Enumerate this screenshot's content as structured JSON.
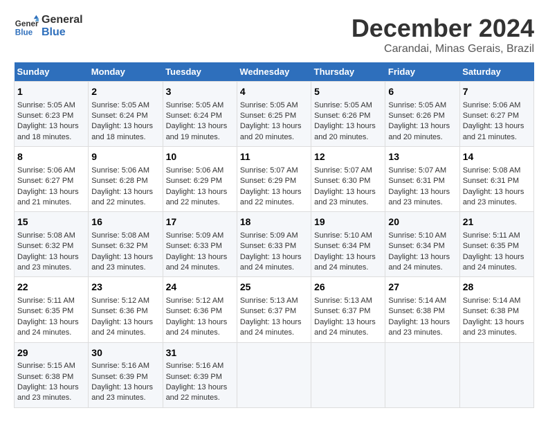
{
  "header": {
    "logo_line1": "General",
    "logo_line2": "Blue",
    "title": "December 2024",
    "subtitle": "Carandai, Minas Gerais, Brazil"
  },
  "days_of_week": [
    "Sunday",
    "Monday",
    "Tuesday",
    "Wednesday",
    "Thursday",
    "Friday",
    "Saturday"
  ],
  "weeks": [
    [
      {
        "day": "1",
        "sunrise": "5:05 AM",
        "sunset": "6:23 PM",
        "daylight": "13 hours and 18 minutes."
      },
      {
        "day": "2",
        "sunrise": "5:05 AM",
        "sunset": "6:24 PM",
        "daylight": "13 hours and 18 minutes."
      },
      {
        "day": "3",
        "sunrise": "5:05 AM",
        "sunset": "6:24 PM",
        "daylight": "13 hours and 19 minutes."
      },
      {
        "day": "4",
        "sunrise": "5:05 AM",
        "sunset": "6:25 PM",
        "daylight": "13 hours and 20 minutes."
      },
      {
        "day": "5",
        "sunrise": "5:05 AM",
        "sunset": "6:26 PM",
        "daylight": "13 hours and 20 minutes."
      },
      {
        "day": "6",
        "sunrise": "5:05 AM",
        "sunset": "6:26 PM",
        "daylight": "13 hours and 20 minutes."
      },
      {
        "day": "7",
        "sunrise": "5:06 AM",
        "sunset": "6:27 PM",
        "daylight": "13 hours and 21 minutes."
      }
    ],
    [
      {
        "day": "8",
        "sunrise": "5:06 AM",
        "sunset": "6:27 PM",
        "daylight": "13 hours and 21 minutes."
      },
      {
        "day": "9",
        "sunrise": "5:06 AM",
        "sunset": "6:28 PM",
        "daylight": "13 hours and 22 minutes."
      },
      {
        "day": "10",
        "sunrise": "5:06 AM",
        "sunset": "6:29 PM",
        "daylight": "13 hours and 22 minutes."
      },
      {
        "day": "11",
        "sunrise": "5:07 AM",
        "sunset": "6:29 PM",
        "daylight": "13 hours and 22 minutes."
      },
      {
        "day": "12",
        "sunrise": "5:07 AM",
        "sunset": "6:30 PM",
        "daylight": "13 hours and 23 minutes."
      },
      {
        "day": "13",
        "sunrise": "5:07 AM",
        "sunset": "6:31 PM",
        "daylight": "13 hours and 23 minutes."
      },
      {
        "day": "14",
        "sunrise": "5:08 AM",
        "sunset": "6:31 PM",
        "daylight": "13 hours and 23 minutes."
      }
    ],
    [
      {
        "day": "15",
        "sunrise": "5:08 AM",
        "sunset": "6:32 PM",
        "daylight": "13 hours and 23 minutes."
      },
      {
        "day": "16",
        "sunrise": "5:08 AM",
        "sunset": "6:32 PM",
        "daylight": "13 hours and 23 minutes."
      },
      {
        "day": "17",
        "sunrise": "5:09 AM",
        "sunset": "6:33 PM",
        "daylight": "13 hours and 24 minutes."
      },
      {
        "day": "18",
        "sunrise": "5:09 AM",
        "sunset": "6:33 PM",
        "daylight": "13 hours and 24 minutes."
      },
      {
        "day": "19",
        "sunrise": "5:10 AM",
        "sunset": "6:34 PM",
        "daylight": "13 hours and 24 minutes."
      },
      {
        "day": "20",
        "sunrise": "5:10 AM",
        "sunset": "6:34 PM",
        "daylight": "13 hours and 24 minutes."
      },
      {
        "day": "21",
        "sunrise": "5:11 AM",
        "sunset": "6:35 PM",
        "daylight": "13 hours and 24 minutes."
      }
    ],
    [
      {
        "day": "22",
        "sunrise": "5:11 AM",
        "sunset": "6:35 PM",
        "daylight": "13 hours and 24 minutes."
      },
      {
        "day": "23",
        "sunrise": "5:12 AM",
        "sunset": "6:36 PM",
        "daylight": "13 hours and 24 minutes."
      },
      {
        "day": "24",
        "sunrise": "5:12 AM",
        "sunset": "6:36 PM",
        "daylight": "13 hours and 24 minutes."
      },
      {
        "day": "25",
        "sunrise": "5:13 AM",
        "sunset": "6:37 PM",
        "daylight": "13 hours and 24 minutes."
      },
      {
        "day": "26",
        "sunrise": "5:13 AM",
        "sunset": "6:37 PM",
        "daylight": "13 hours and 24 minutes."
      },
      {
        "day": "27",
        "sunrise": "5:14 AM",
        "sunset": "6:38 PM",
        "daylight": "13 hours and 23 minutes."
      },
      {
        "day": "28",
        "sunrise": "5:14 AM",
        "sunset": "6:38 PM",
        "daylight": "13 hours and 23 minutes."
      }
    ],
    [
      {
        "day": "29",
        "sunrise": "5:15 AM",
        "sunset": "6:38 PM",
        "daylight": "13 hours and 23 minutes."
      },
      {
        "day": "30",
        "sunrise": "5:16 AM",
        "sunset": "6:39 PM",
        "daylight": "13 hours and 23 minutes."
      },
      {
        "day": "31",
        "sunrise": "5:16 AM",
        "sunset": "6:39 PM",
        "daylight": "13 hours and 22 minutes."
      },
      null,
      null,
      null,
      null
    ]
  ],
  "labels": {
    "sunrise_prefix": "Sunrise: ",
    "sunset_prefix": "Sunset: ",
    "daylight_prefix": "Daylight: "
  }
}
